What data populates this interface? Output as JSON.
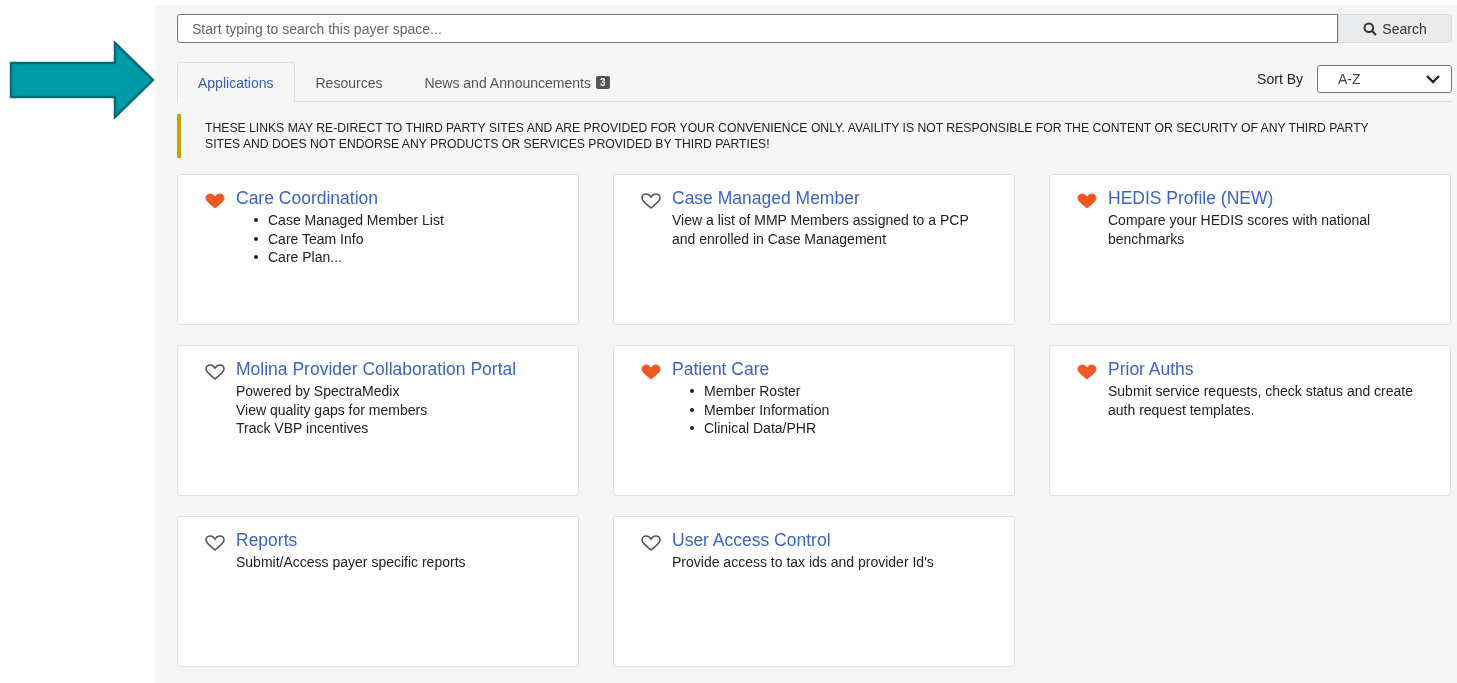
{
  "search": {
    "placeholder": "Start typing to search this payer space...",
    "button": "Search"
  },
  "tabs": [
    {
      "label": "Applications",
      "selected": true
    },
    {
      "label": "Resources",
      "selected": false
    },
    {
      "label": "News and Announcements",
      "selected": false,
      "badge": "3"
    }
  ],
  "sort": {
    "label": "Sort By",
    "value": "A-Z"
  },
  "notice": "THESE LINKS MAY RE-DIRECT TO THIRD PARTY SITES AND ARE PROVIDED FOR YOUR CONVENIENCE ONLY. AVAILITY IS NOT RESPONSIBLE FOR THE CONTENT OR SECURITY OF ANY THIRD PARTY SITES AND DOES NOT ENDORSE ANY PRODUCTS OR SERVICES PROVIDED BY THIRD PARTIES!",
  "cards": [
    {
      "title": "Care Coordination",
      "favorite": true,
      "kind": "bullets",
      "lines": [
        "Case Managed Member List",
        "Care Team Info",
        "Care Plan..."
      ]
    },
    {
      "title": "Case Managed Member",
      "favorite": false,
      "kind": "text",
      "lines": [
        "View a list of MMP Members assigned to a PCP and enrolled in Case Management"
      ]
    },
    {
      "title": "HEDIS Profile (NEW)",
      "favorite": true,
      "kind": "text",
      "lines": [
        "Compare your HEDIS scores with national benchmarks"
      ]
    },
    {
      "title": "Molina Provider Collaboration Portal",
      "favorite": false,
      "kind": "text",
      "lines": [
        "Powered by SpectraMedix",
        "View quality gaps for members",
        "Track VBP incentives"
      ]
    },
    {
      "title": "Patient Care",
      "favorite": true,
      "kind": "bullets",
      "lines": [
        "Member Roster",
        "Member Information",
        "Clinical Data/PHR"
      ]
    },
    {
      "title": "Prior Auths",
      "favorite": true,
      "kind": "text",
      "lines": [
        "Submit service requests, check status and create auth request templates."
      ]
    },
    {
      "title": "Reports",
      "favorite": false,
      "kind": "text",
      "lines": [
        "Submit/Access payer specific reports"
      ]
    },
    {
      "title": "User Access Control",
      "favorite": false,
      "kind": "text",
      "lines": [
        "Provide access to tax ids and provider Id's"
      ]
    }
  ]
}
